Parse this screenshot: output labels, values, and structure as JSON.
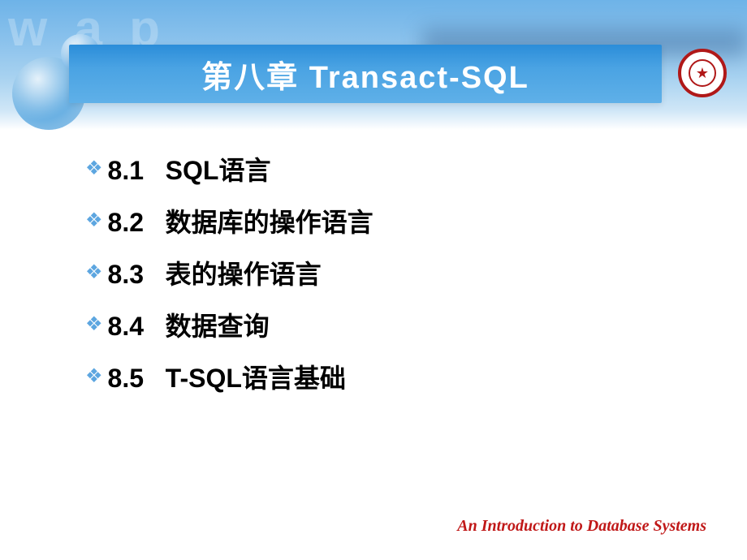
{
  "header": {
    "bg_letters": "w a p",
    "title": "第八章   Transact-SQL"
  },
  "items": [
    {
      "number": "8.1",
      "label": "SQL语言"
    },
    {
      "number": "8.2",
      "label": "数据库的操作语言"
    },
    {
      "number": "8.3",
      "label": "表的操作语言"
    },
    {
      "number": "8.4",
      "label": "数据查询"
    },
    {
      "number": "8.5",
      "label": "T-SQL语言基础"
    }
  ],
  "footer": {
    "text": "An Introduction to Database Systems"
  },
  "seal": {
    "symbol": "★"
  }
}
